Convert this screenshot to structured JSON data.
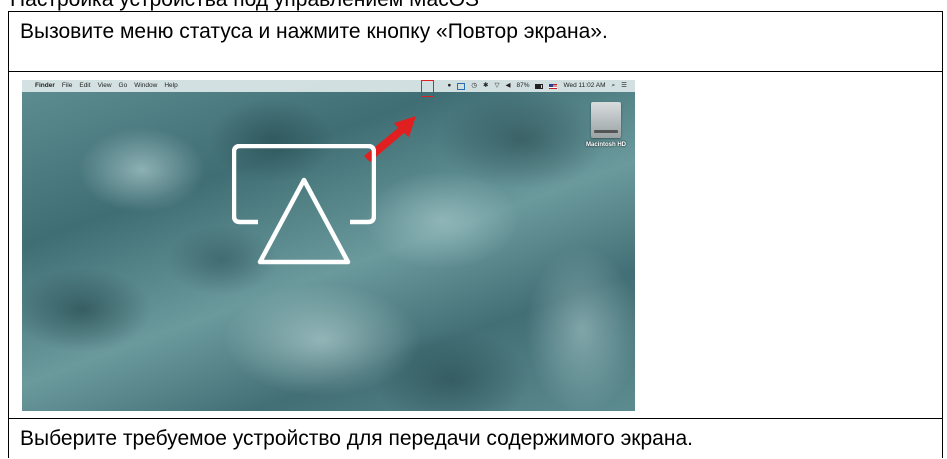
{
  "document": {
    "heading": "Настройка устройства под управлением MacOS",
    "step1_text": "Вызовите меню статуса и нажмите кнопку «Повтор экрана».",
    "step2_text": "Выберите требуемое устройство для передачи содержимого экрана."
  },
  "screenshot": {
    "menubar": {
      "apple": "",
      "app_name": "Finder",
      "menus": [
        "File",
        "Edit",
        "View",
        "Go",
        "Window",
        "Help"
      ],
      "battery": "87%",
      "clock": "Wed 11:02 AM"
    },
    "desktop_icon_label": "Macintosh HD",
    "highlight_color": "#e02020",
    "arrow_color": "#e02020"
  }
}
